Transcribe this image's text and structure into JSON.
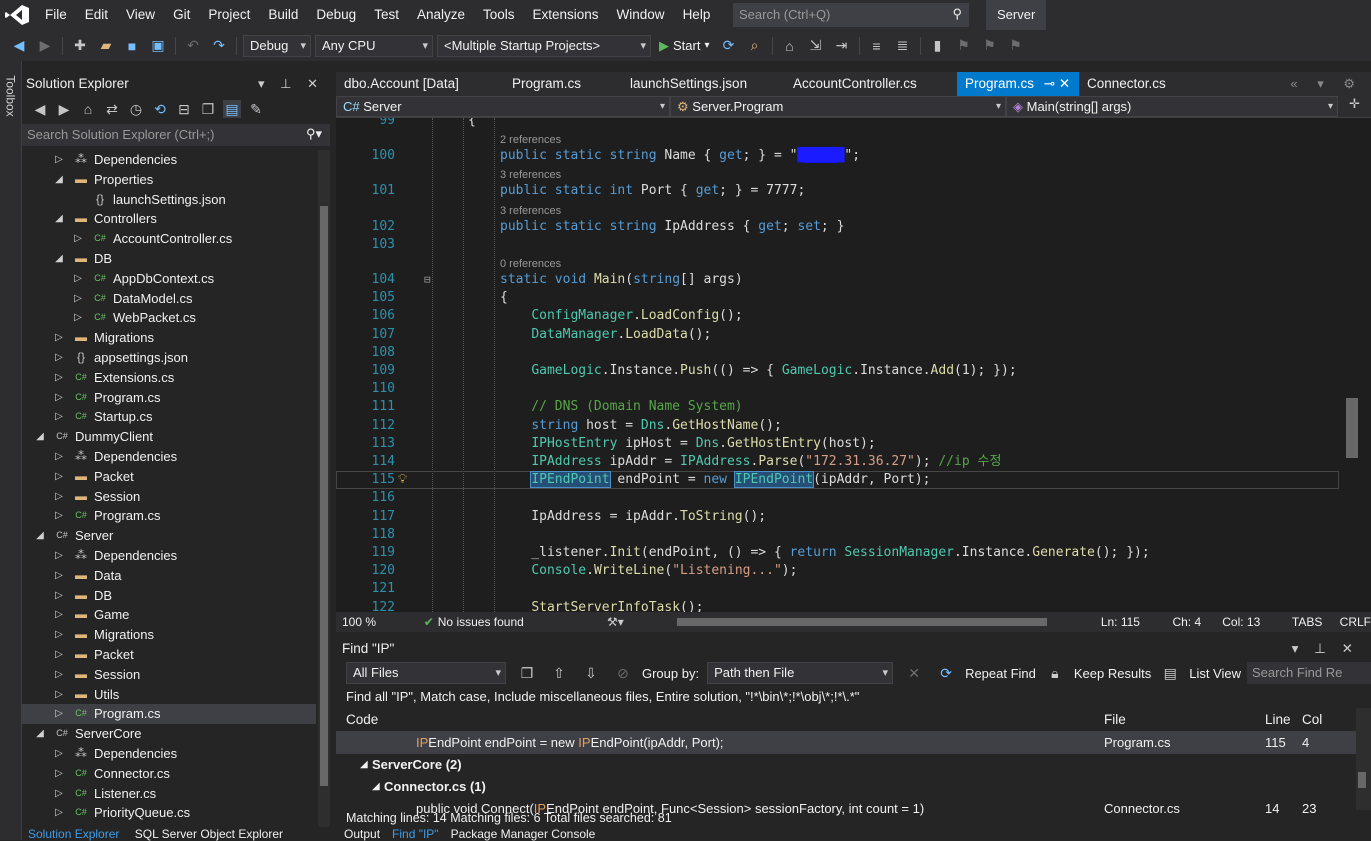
{
  "menubar": {
    "items": [
      "File",
      "Edit",
      "View",
      "Git",
      "Project",
      "Build",
      "Debug",
      "Test",
      "Analyze",
      "Tools",
      "Extensions",
      "Window",
      "Help"
    ],
    "search_placeholder": "Search (Ctrl+Q)",
    "solution_name": "Server"
  },
  "toolbar": {
    "config": "Debug",
    "platform": "Any CPU",
    "startup": "<Multiple Startup Projects>",
    "start_label": "Start"
  },
  "toolbox_label": "Toolbox",
  "solution_explorer": {
    "title": "Solution Explorer",
    "search_placeholder": "Search Solution Explorer (Ctrl+;)",
    "tree": [
      {
        "label": "Dependencies",
        "level": 2,
        "icon": "deps-icon",
        "expand": "closed"
      },
      {
        "label": "Properties",
        "level": 2,
        "icon": "folder-icon",
        "expand": "open"
      },
      {
        "label": "launchSettings.json",
        "level": 3,
        "icon": "json-icon",
        "expand": "none"
      },
      {
        "label": "Controllers",
        "level": 2,
        "icon": "folder-icon",
        "expand": "open"
      },
      {
        "label": "AccountController.cs",
        "level": 3,
        "icon": "cs-icon",
        "expand": "closed"
      },
      {
        "label": "DB",
        "level": 2,
        "icon": "folder-icon",
        "expand": "open"
      },
      {
        "label": "AppDbContext.cs",
        "level": 3,
        "icon": "cs-icon",
        "expand": "closed"
      },
      {
        "label": "DataModel.cs",
        "level": 3,
        "icon": "cs-icon",
        "expand": "closed"
      },
      {
        "label": "WebPacket.cs",
        "level": 3,
        "icon": "cs-icon",
        "expand": "closed"
      },
      {
        "label": "Migrations",
        "level": 2,
        "icon": "folder-icon",
        "expand": "closed"
      },
      {
        "label": "appsettings.json",
        "level": 2,
        "icon": "json-icon",
        "expand": "closed"
      },
      {
        "label": "Extensions.cs",
        "level": 2,
        "icon": "cs-icon",
        "expand": "closed"
      },
      {
        "label": "Program.cs",
        "level": 2,
        "icon": "cs-icon",
        "expand": "closed"
      },
      {
        "label": "Startup.cs",
        "level": 2,
        "icon": "cs-icon",
        "expand": "closed"
      },
      {
        "label": "DummyClient",
        "level": 1,
        "icon": "project-icon",
        "expand": "open"
      },
      {
        "label": "Dependencies",
        "level": 2,
        "icon": "deps-icon",
        "expand": "closed"
      },
      {
        "label": "Packet",
        "level": 2,
        "icon": "folder-icon",
        "expand": "closed"
      },
      {
        "label": "Session",
        "level": 2,
        "icon": "folder-icon",
        "expand": "closed"
      },
      {
        "label": "Program.cs",
        "level": 2,
        "icon": "cs-icon",
        "expand": "closed"
      },
      {
        "label": "Server",
        "level": 1,
        "icon": "project-icon",
        "expand": "open"
      },
      {
        "label": "Dependencies",
        "level": 2,
        "icon": "deps-icon",
        "expand": "closed"
      },
      {
        "label": "Data",
        "level": 2,
        "icon": "folder-icon",
        "expand": "closed"
      },
      {
        "label": "DB",
        "level": 2,
        "icon": "folder-icon",
        "expand": "closed"
      },
      {
        "label": "Game",
        "level": 2,
        "icon": "folder-icon",
        "expand": "closed"
      },
      {
        "label": "Migrations",
        "level": 2,
        "icon": "folder-icon",
        "expand": "closed"
      },
      {
        "label": "Packet",
        "level": 2,
        "icon": "folder-icon",
        "expand": "closed"
      },
      {
        "label": "Session",
        "level": 2,
        "icon": "folder-icon",
        "expand": "closed"
      },
      {
        "label": "Utils",
        "level": 2,
        "icon": "folder-icon",
        "expand": "closed"
      },
      {
        "label": "Program.cs",
        "level": 2,
        "icon": "cs-icon",
        "expand": "closed",
        "selected": true
      },
      {
        "label": "ServerCore",
        "level": 1,
        "icon": "project-icon",
        "expand": "open"
      },
      {
        "label": "Dependencies",
        "level": 2,
        "icon": "deps-icon",
        "expand": "closed"
      },
      {
        "label": "Connector.cs",
        "level": 2,
        "icon": "cs-icon",
        "expand": "closed"
      },
      {
        "label": "Listener.cs",
        "level": 2,
        "icon": "cs-icon",
        "expand": "closed"
      },
      {
        "label": "PriorityQueue.cs",
        "level": 2,
        "icon": "cs-icon",
        "expand": "closed"
      }
    ],
    "bottom_tabs": [
      "Solution Explorer",
      "SQL Server Object Explorer"
    ]
  },
  "editor": {
    "tabs": [
      "dbo.Account [Data]",
      "Program.cs",
      "launchSettings.json",
      "AccountController.cs",
      "Program.cs",
      "Connector.cs"
    ],
    "active_tab": 4,
    "nav": {
      "project": "Server",
      "type": "Server.Program",
      "member": "Main(string[] args)"
    },
    "lines": [
      {
        "n": "99",
        "ref": "",
        "segs": [
          [
            "{",
            "p"
          ]
        ]
      },
      {
        "n": "100",
        "ref": "2 references",
        "segs": [
          [
            "public static ",
            "kw"
          ],
          [
            "string ",
            "kw"
          ],
          [
            "Name { ",
            "p"
          ],
          [
            "get",
            "kw"
          ],
          [
            "; } = \"",
            "p"
          ],
          [
            "██████",
            "red"
          ],
          [
            "\";",
            "p"
          ]
        ]
      },
      {
        "n": "101",
        "ref": "3 references",
        "segs": [
          [
            "public static ",
            "kw"
          ],
          [
            "int ",
            "kw"
          ],
          [
            "Port { ",
            "p"
          ],
          [
            "get",
            "kw"
          ],
          [
            "; } = ",
            "p"
          ],
          [
            "7777",
            "p"
          ],
          [
            ";",
            "p"
          ]
        ]
      },
      {
        "n": "102",
        "ref": "3 references",
        "segs": [
          [
            "public static ",
            "kw"
          ],
          [
            "string ",
            "kw"
          ],
          [
            "IpAddress { ",
            "p"
          ],
          [
            "get",
            "kw"
          ],
          [
            "; ",
            "p"
          ],
          [
            "set",
            "kw"
          ],
          [
            "; }",
            "p"
          ]
        ]
      },
      {
        "n": "103",
        "ref": "",
        "segs": []
      },
      {
        "n": "104",
        "ref": "0 references",
        "segs": [
          [
            "static ",
            "kw"
          ],
          [
            "void ",
            "kw"
          ],
          [
            "Main",
            "md"
          ],
          [
            "(",
            "p"
          ],
          [
            "string",
            "kw"
          ],
          [
            "[] args)",
            "p"
          ]
        ]
      },
      {
        "n": "105",
        "ref": "",
        "segs": [
          [
            "{",
            "p"
          ]
        ]
      },
      {
        "n": "106",
        "ref": "",
        "segs": [
          [
            "    ",
            "p"
          ],
          [
            "ConfigManager",
            "ty"
          ],
          [
            ".",
            "p"
          ],
          [
            "LoadConfig",
            "md"
          ],
          [
            "();",
            "p"
          ]
        ]
      },
      {
        "n": "107",
        "ref": "",
        "segs": [
          [
            "    ",
            "p"
          ],
          [
            "DataManager",
            "ty"
          ],
          [
            ".",
            "p"
          ],
          [
            "LoadData",
            "md"
          ],
          [
            "();",
            "p"
          ]
        ]
      },
      {
        "n": "108",
        "ref": "",
        "segs": []
      },
      {
        "n": "109",
        "ref": "",
        "segs": [
          [
            "    ",
            "p"
          ],
          [
            "GameLogic",
            "ty"
          ],
          [
            ".Instance.",
            "p"
          ],
          [
            "Push",
            "md"
          ],
          [
            "(() => { ",
            "p"
          ],
          [
            "GameLogic",
            "ty"
          ],
          [
            ".Instance.",
            "p"
          ],
          [
            "Add",
            "md"
          ],
          [
            "(1); });",
            "p"
          ]
        ]
      },
      {
        "n": "110",
        "ref": "",
        "segs": []
      },
      {
        "n": "111",
        "ref": "",
        "segs": [
          [
            "    // DNS (Domain Name System)",
            "cm"
          ]
        ]
      },
      {
        "n": "112",
        "ref": "",
        "segs": [
          [
            "    ",
            "p"
          ],
          [
            "string ",
            "kw"
          ],
          [
            "host = ",
            "p"
          ],
          [
            "Dns",
            "ty"
          ],
          [
            ".",
            "p"
          ],
          [
            "GetHostName",
            "md"
          ],
          [
            "();",
            "p"
          ]
        ]
      },
      {
        "n": "113",
        "ref": "",
        "segs": [
          [
            "    ",
            "p"
          ],
          [
            "IPHostEntry",
            "ty"
          ],
          [
            " ipHost = ",
            "p"
          ],
          [
            "Dns",
            "ty"
          ],
          [
            ".",
            "p"
          ],
          [
            "GetHostEntry",
            "md"
          ],
          [
            "(host);",
            "p"
          ]
        ]
      },
      {
        "n": "114",
        "ref": "",
        "segs": [
          [
            "    ",
            "p"
          ],
          [
            "IPAddress",
            "ty"
          ],
          [
            " ipAddr = ",
            "p"
          ],
          [
            "IPAddress",
            "ty"
          ],
          [
            ".",
            "p"
          ],
          [
            "Parse",
            "md"
          ],
          [
            "(",
            "p"
          ],
          [
            "\"172.31.36.27\"",
            "st"
          ],
          [
            "); ",
            "p"
          ],
          [
            "//ip 수정",
            "cm"
          ]
        ]
      },
      {
        "n": "115",
        "ref": "",
        "segs": [
          [
            "    ",
            "p"
          ],
          [
            "IPEndPoint",
            "hlty"
          ],
          [
            " endPoint = ",
            "p"
          ],
          [
            "new ",
            "kw"
          ],
          [
            "IPEndPoint",
            "hlty"
          ],
          [
            "(ipAddr, Port);",
            "p"
          ]
        ]
      },
      {
        "n": "116",
        "ref": "",
        "segs": []
      },
      {
        "n": "117",
        "ref": "",
        "segs": [
          [
            "    IpAddress = ipAddr.",
            "p"
          ],
          [
            "ToString",
            "md"
          ],
          [
            "();",
            "p"
          ]
        ]
      },
      {
        "n": "118",
        "ref": "",
        "segs": []
      },
      {
        "n": "119",
        "ref": "",
        "segs": [
          [
            "    _listener.",
            "p"
          ],
          [
            "Init",
            "md"
          ],
          [
            "(endPoint, () => { ",
            "p"
          ],
          [
            "return ",
            "kw"
          ],
          [
            "SessionManager",
            "ty"
          ],
          [
            ".Instance.",
            "p"
          ],
          [
            "Generate",
            "md"
          ],
          [
            "(); });",
            "p"
          ]
        ]
      },
      {
        "n": "120",
        "ref": "",
        "segs": [
          [
            "    ",
            "p"
          ],
          [
            "Console",
            "ty"
          ],
          [
            ".",
            "p"
          ],
          [
            "WriteLine",
            "md"
          ],
          [
            "(",
            "p"
          ],
          [
            "\"Listening...\"",
            "st"
          ],
          [
            ");",
            "p"
          ]
        ]
      },
      {
        "n": "121",
        "ref": "",
        "segs": []
      },
      {
        "n": "122",
        "ref": "",
        "segs": [
          [
            "    ",
            "p"
          ],
          [
            "StartServerInfoTask",
            "md"
          ],
          [
            "();",
            "p"
          ]
        ]
      }
    ],
    "status": {
      "zoom": "100 %",
      "issues": "No issues found",
      "ln": "Ln: 115",
      "ch": "Ch: 4",
      "col": "Col: 13",
      "tabs": "TABS",
      "eol": "CRLF"
    }
  },
  "find": {
    "title": "Find \"IP\"",
    "scope": "All Files",
    "group_by_label": "Group by:",
    "group_by": "Path then File",
    "repeat": "Repeat Find",
    "keep": "Keep Results",
    "list_view": "List View",
    "search_placeholder": "Search Find Re",
    "description": "Find all \"IP\", Match case, Include miscellaneous files, Entire solution, \"!*\\bin\\*;!*\\obj\\*;!*\\.*\"",
    "headers": {
      "code": "Code",
      "file": "File",
      "line": "Line",
      "col": "Col"
    },
    "rows": [
      {
        "kind": "match",
        "pre": "",
        "m1": "IP",
        "mid": "EndPoint endPoint = new ",
        "m2": "IP",
        "post": "EndPoint(ipAddr, Port);",
        "file": "Program.cs",
        "line": "115",
        "col": "4"
      },
      {
        "kind": "group",
        "label": "ServerCore  (2)"
      },
      {
        "kind": "file",
        "label": "Connector.cs  (1)"
      },
      {
        "kind": "match",
        "pre": "public void Connect(",
        "m1": "IP",
        "mid": "EndPoint endPoint, Func<Session> sessionFactory, int count = 1)",
        "m2": "",
        "post": "",
        "file": "Connector.cs",
        "line": "14",
        "col": "23"
      }
    ],
    "status": "Matching lines: 14 Matching files: 6 Total files searched: 81"
  },
  "bottom_tabs": [
    "Output",
    "Find \"IP\"",
    "Package Manager Console"
  ]
}
